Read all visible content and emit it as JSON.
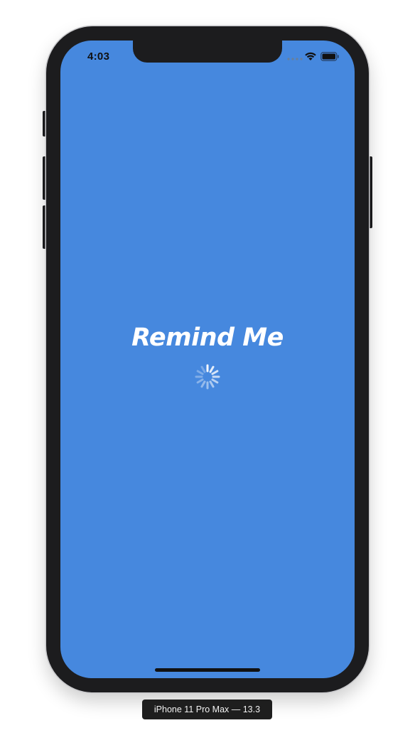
{
  "status_bar": {
    "time": "4:03",
    "icons": [
      "cellular-signal-icon",
      "wifi-icon",
      "battery-icon"
    ]
  },
  "splash": {
    "title": "Remind Me",
    "loading_indicator": "activity-spinner-icon"
  },
  "device_label": "iPhone 11 Pro Max — 13.3",
  "colors": {
    "screen_background": "#4688de",
    "title_text": "#ffffff",
    "device_frame": "#1c1c1e",
    "status_text": "#111111"
  }
}
